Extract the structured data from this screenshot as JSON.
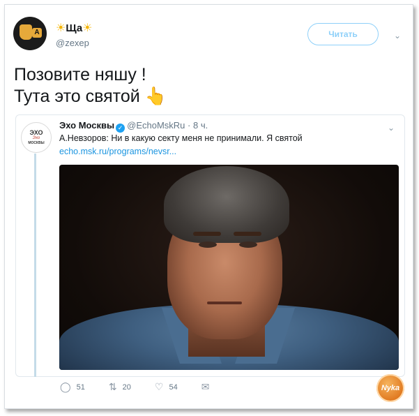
{
  "author": {
    "display_name": "Ща",
    "display_prefix_emoji": "☀",
    "display_suffix_emoji": "☀",
    "handle": "@zexep",
    "avatar_badge": "A"
  },
  "follow_button": {
    "label": "Читать"
  },
  "tweet": {
    "line1": "Позовите няшу !",
    "line2": "Тута это святой",
    "emoji": "👆"
  },
  "quote": {
    "avatar": {
      "line1": "ЭХО",
      "line2": "Эхо",
      "line3": "МОСКВЫ"
    },
    "name": "Эхо Москвы",
    "handle": "@EchoMskRu",
    "separator": "·",
    "time": "8 ч.",
    "text": "А.Невзоров: Ни в какую секту меня не принимали. Я святой",
    "link": "echo.msk.ru/programs/nevsr..."
  },
  "actions": {
    "replies": "51",
    "retweets": "20",
    "likes": "54"
  },
  "watermark": "Nyka",
  "icons": {
    "reply": "reply-icon",
    "retweet": "retweet-icon",
    "like": "heart-icon",
    "message": "envelope-icon",
    "menu": "chevron-down-icon",
    "verified": "verified-badge-icon"
  },
  "colors": {
    "accent": "#1da1f2",
    "follow_border": "#8ed0f9",
    "link": "#1b95e0",
    "muted": "#657786"
  }
}
